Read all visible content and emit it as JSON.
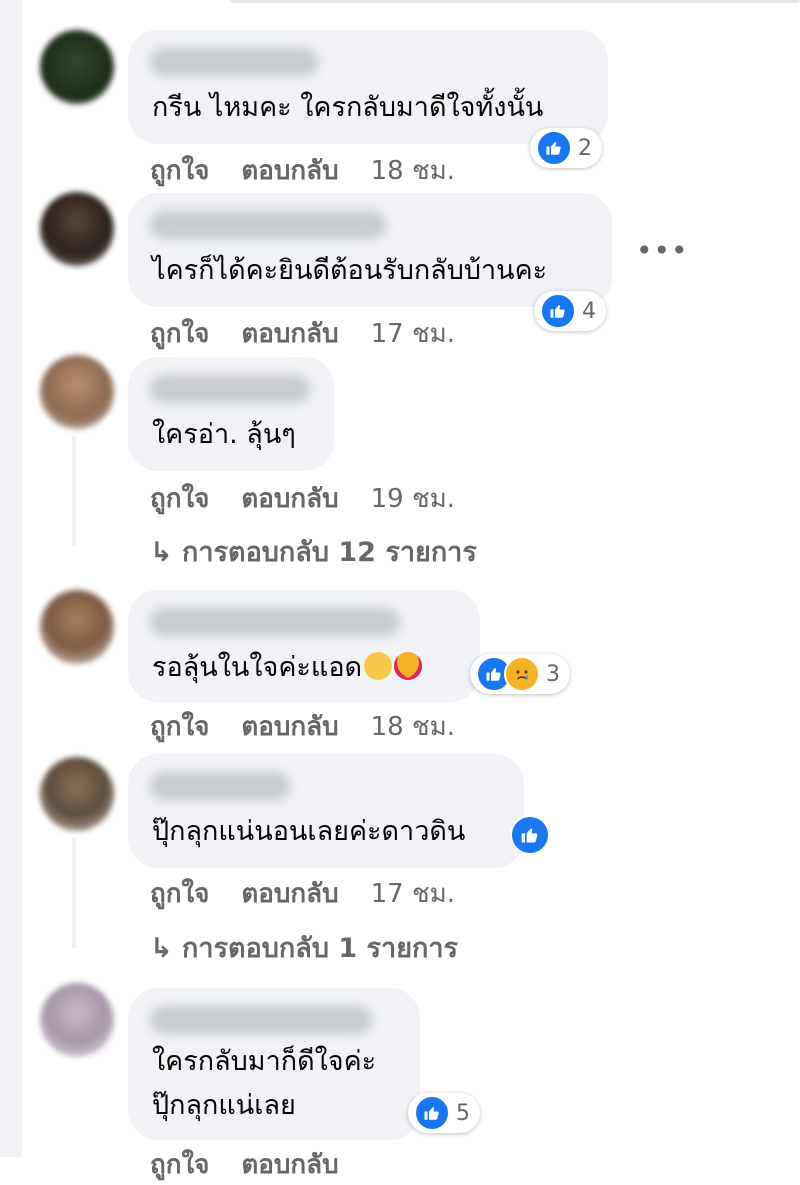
{
  "actions": {
    "like_label": "ถูกใจ",
    "reply_label": "ตอบกลับ"
  },
  "comments": [
    {
      "text": "กรีน ไหมคะ ใครกลับมาดีใจทั้งนั้น",
      "time": "18 ชม.",
      "reaction_count": "2"
    },
    {
      "text": "ไครก็ได้คะยินดีต้อนรับกลับบ้านคะ",
      "time": "17 ชม.",
      "reaction_count": "4"
    },
    {
      "text": "ใครอ่า. ลุ้นๆ",
      "time": "19 ชม.",
      "replies": "การตอบกลับ 12 รายการ"
    },
    {
      "text": "รอลุ้นในใจค่ะแอด",
      "time": "18 ชม.",
      "reaction_count": "3"
    },
    {
      "text": "ปุ๊กลุกแน่นอนเลยค่ะดาวดิน",
      "time": "17 ชม.",
      "replies": "การตอบกลับ 1 รายการ"
    },
    {
      "text_line1": "ใครกลับมาก็ดีใจค่ะ",
      "text_line2": "ปุ๊กลุกแน่เลย",
      "reaction_count": "5"
    }
  ],
  "more_icon": "more-options-icon",
  "colors": {
    "bubble": "#f0f2f5",
    "meta": "#65676b",
    "like_blue": "#1877f2",
    "sad_yellow": "#f7b125"
  }
}
